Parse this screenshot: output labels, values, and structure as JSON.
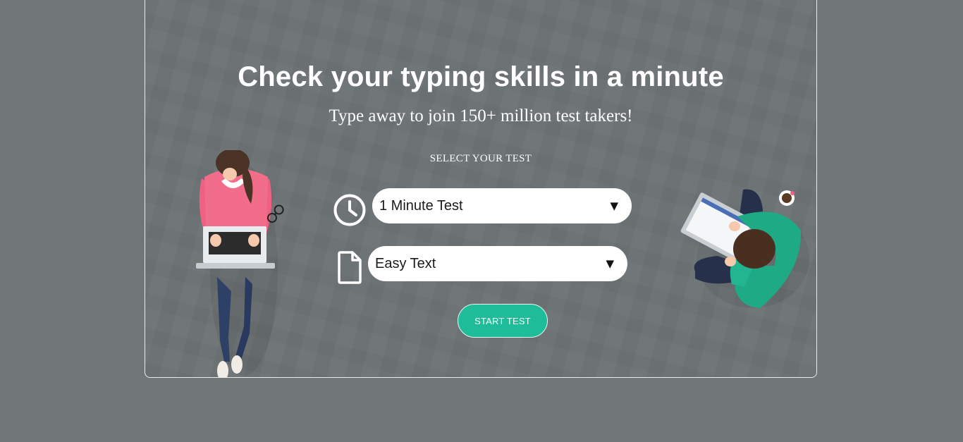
{
  "hero": {
    "title": "Check your typing skills in a minute",
    "subtitle": "Type away to join 150+ million test takers!",
    "select_label": "SELECT YOUR TEST"
  },
  "test_options": {
    "duration": {
      "icon": "clock-icon",
      "selected": "1 Minute Test"
    },
    "text_type": {
      "icon": "document-icon",
      "selected": "Easy Text"
    }
  },
  "start_button": {
    "label": "START TEST"
  },
  "colors": {
    "background": "#717779",
    "accent": "#1ebc98",
    "card_border": "#e9ecec"
  }
}
